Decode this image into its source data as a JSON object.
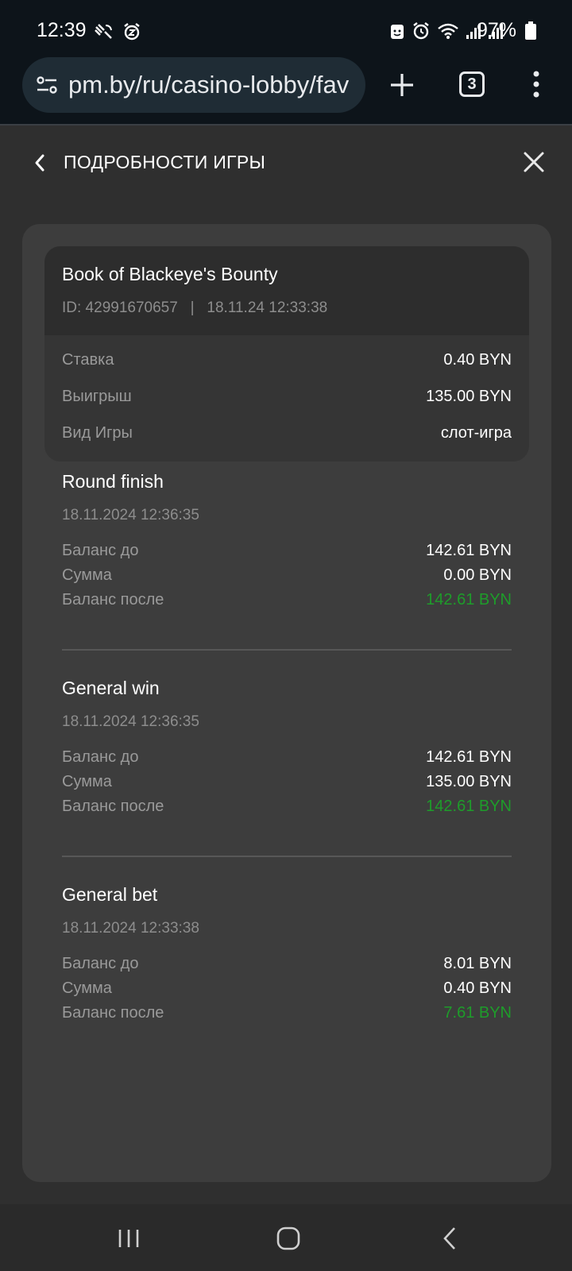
{
  "status_bar": {
    "time": "12:39",
    "battery": "97%",
    "left_icons": [
      "satellite-icon",
      "alarm-snooze-icon"
    ],
    "right_icons": [
      "lock-face-icon",
      "alarm-icon",
      "wifi-icon",
      "signal-icon",
      "signal-icon",
      "battery-icon"
    ]
  },
  "browser": {
    "url": "pm.by/ru/casino-lobby/fav",
    "tab_count": "3"
  },
  "header": {
    "title": "ПОДРОБНОСТИ ИГРЫ"
  },
  "game": {
    "title": "Book of Blackeye's Bounty",
    "id": "ID: 42991670657",
    "separator": "|",
    "datetime": "18.11.24 12:33:38",
    "rows": [
      {
        "label": "Ставка",
        "value": "0.40 BYN"
      },
      {
        "label": "Выигрыш",
        "value": "135.00 BYN"
      },
      {
        "label": "Вид Игры",
        "value": "слот-игра"
      }
    ]
  },
  "transactions": [
    {
      "title": "Round finish",
      "date": "18.11.2024 12:36:35",
      "rows": [
        {
          "label": "Баланс до",
          "value": "142.61 BYN"
        },
        {
          "label": "Сумма",
          "value": "0.00 BYN"
        },
        {
          "label": "Баланс после",
          "value": "142.61 BYN"
        }
      ]
    },
    {
      "title": "General win",
      "date": "18.11.2024 12:36:35",
      "rows": [
        {
          "label": "Баланс до",
          "value": "142.61 BYN"
        },
        {
          "label": "Сумма",
          "value": "135.00 BYN"
        },
        {
          "label": "Баланс после",
          "value": "142.61 BYN"
        }
      ]
    },
    {
      "title": "General bet",
      "date": "18.11.2024 12:33:38",
      "rows": [
        {
          "label": "Баланс до",
          "value": "8.01 BYN"
        },
        {
          "label": "Сумма",
          "value": "0.40 BYN"
        },
        {
          "label": "Баланс после",
          "value": "7.61 BYN"
        }
      ]
    }
  ],
  "colors": {
    "accent_green": "#1e9c2a",
    "background": "#2f2f2f",
    "card": "#3d3d3d"
  }
}
